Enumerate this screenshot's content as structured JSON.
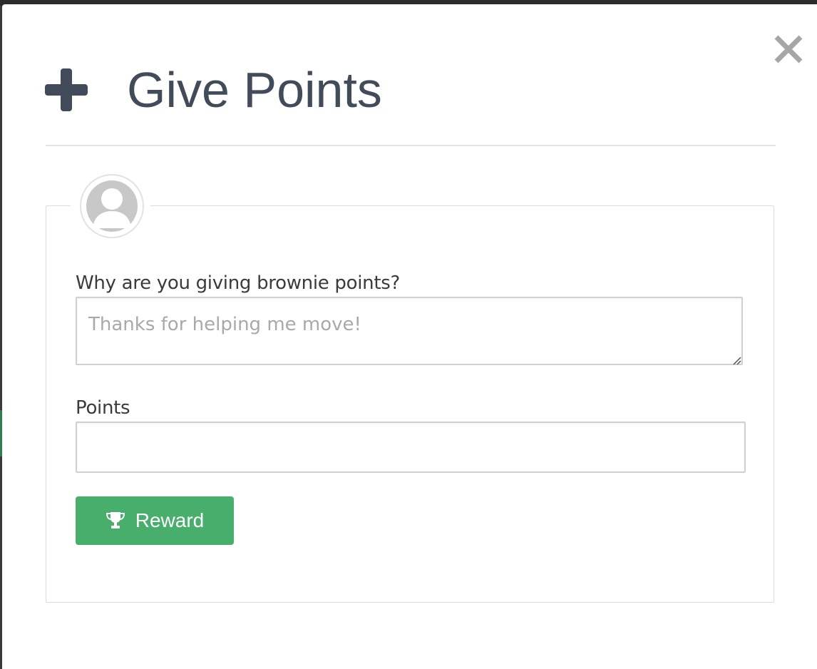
{
  "modal": {
    "title": "Give Points",
    "close_icon": "close-icon",
    "header_icon": "plus-icon"
  },
  "form": {
    "avatar_icon": "user-avatar-icon",
    "reason_label": "Why are you giving brownie points?",
    "reason_placeholder": "Thanks for helping me move!",
    "reason_value": "",
    "points_label": "Points",
    "points_value": "",
    "reward_button_label": "Reward",
    "reward_icon": "trophy-icon"
  },
  "colors": {
    "title_text": "#414b5a",
    "reward_button": "#47ae6b",
    "close_icon": "#a6a6a6",
    "border": "#dcdcdc"
  }
}
